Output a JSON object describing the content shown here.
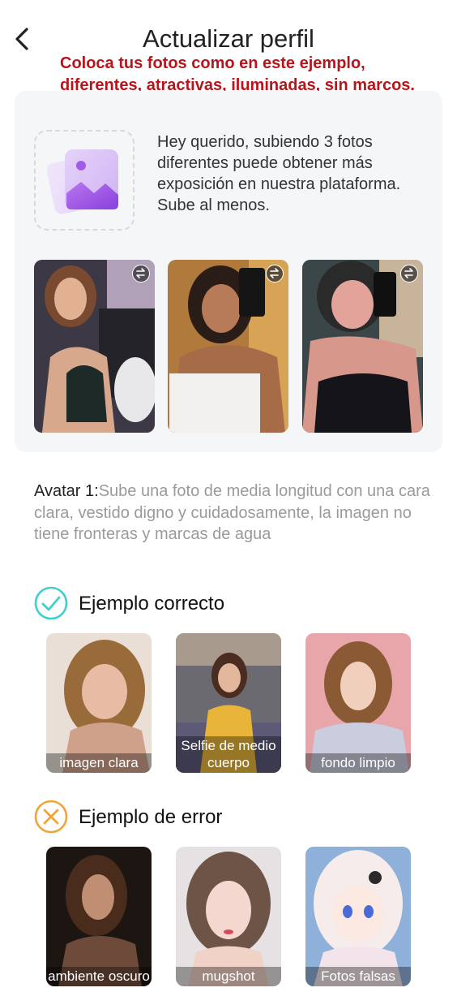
{
  "header": {
    "title": "Actualizar perfil"
  },
  "promo": {
    "text": "Coloca tus fotos como en este ejemplo, diferentes, atractivas, iluminadas, sin marcos."
  },
  "card": {
    "hint": "Hey querido, subiendo 3 fotos diferentes puede obtener más exposición en nuestra plataforma. Sube al menos.",
    "icons": {
      "placeholder": "image-gallery-icon",
      "swap": "swap-icon"
    }
  },
  "avatar": {
    "label": "Avatar 1:",
    "text": "Sube una foto de media longitud con una cara clara, vestido digno y cuidadosamente, la imagen no tiene fronteras y marcas de agua"
  },
  "correct": {
    "title": "Ejemplo correcto",
    "color": "#3fd0c9",
    "items": [
      "imagen clara",
      "Selfie de medio cuerpo",
      "fondo limpio"
    ]
  },
  "error": {
    "title": "Ejemplo de error",
    "color": "#f2a43a",
    "items": [
      "ambiente oscuro",
      "mugshot",
      "Fotos falsas"
    ]
  }
}
